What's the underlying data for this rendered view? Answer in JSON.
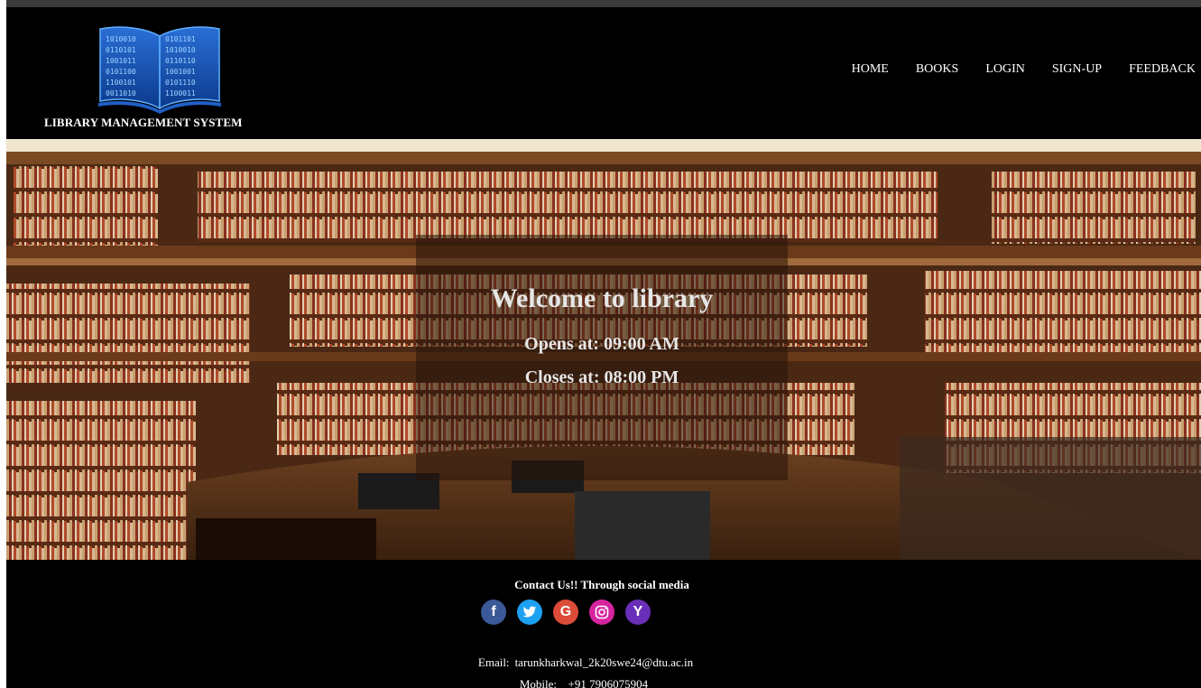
{
  "header": {
    "brand": "LIBRARY MANAGEMENT SYSTEM",
    "logo_icon": "book-binary-logo",
    "nav": [
      {
        "label": "HOME"
      },
      {
        "label": "BOOKS"
      },
      {
        "label": "LOGIN"
      },
      {
        "label": "SIGN-UP"
      },
      {
        "label": "FEEDBACK"
      }
    ]
  },
  "hero": {
    "title": "Welcome to library",
    "opens": "Opens at: 09:00 AM",
    "closes": "Closes at: 08:00 PM"
  },
  "footer": {
    "contact_heading": "Contact Us!!  Through social media",
    "socials": [
      {
        "icon": "facebook-icon",
        "glyph": "f",
        "color": "#3b5998"
      },
      {
        "icon": "twitter-icon",
        "glyph": "🐦",
        "color": "#1da1f2"
      },
      {
        "icon": "google-icon",
        "glyph": "G",
        "color": "#dd4b39"
      },
      {
        "icon": "instagram-icon",
        "glyph": "◎",
        "color": "#d6249f"
      },
      {
        "icon": "yahoo-icon",
        "glyph": "Y",
        "color": "#6a2fb8"
      }
    ],
    "email_label": "Email:",
    "email": "tarunkharkwal_2k20swe24@dtu.ac.in",
    "mobile_label": "Mobile:",
    "mobile": "+91 7906075904"
  },
  "colors": {
    "background": "#000000",
    "text": "#ffffff",
    "overlay": "rgba(40,20,10,0.55)"
  }
}
